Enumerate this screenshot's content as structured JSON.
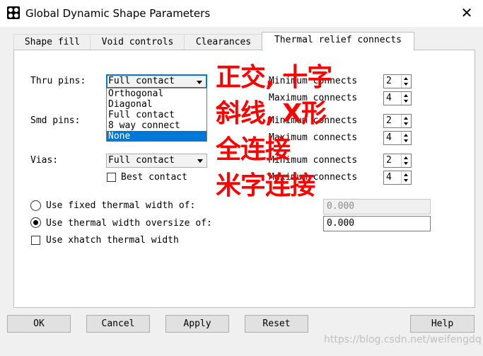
{
  "window": {
    "title": "Global Dynamic Shape Parameters",
    "close_glyph": "✕"
  },
  "tabs": [
    "Shape fill",
    "Void controls",
    "Clearances",
    "Thermal relief connects"
  ],
  "thru_pins": {
    "label": "Thru pins:",
    "selected": "Full contact",
    "options": [
      "Orthogonal",
      "Diagonal",
      "Full contact",
      "8 way connect",
      "None"
    ],
    "highlighted": "None"
  },
  "smd_pins": {
    "label": "Smd pins:"
  },
  "vias": {
    "label": "Vias:",
    "selected": "Full contact",
    "best_contact": "Best contact",
    "best_contact_checked": false
  },
  "connects": {
    "min_label": "Minimum connects",
    "max_label": "Maximum connects",
    "rows": [
      {
        "min": "2",
        "max": "4"
      },
      {
        "min": "2",
        "max": "4"
      },
      {
        "min": "2",
        "max": "4"
      }
    ]
  },
  "width": {
    "fixed_label": "Use fixed thermal width of:",
    "fixed_value": "0.000",
    "fixed_selected": false,
    "oversize_label": "Use thermal width oversize of:",
    "oversize_value": "0.000",
    "oversize_selected": true,
    "xhatch_label": "Use xhatch thermal width",
    "xhatch_checked": false
  },
  "buttons": {
    "ok": "OK",
    "cancel": "Cancel",
    "apply": "Apply",
    "reset": "Reset",
    "help": "Help"
  },
  "annotations": [
    "正交, 十字",
    "斜线, X形",
    "全连接",
    "米字连接"
  ],
  "watermark": "https://blog.csdn.net/weifengdq",
  "colors": {
    "selection": "#0078d7",
    "annotation": "#ff0000"
  }
}
